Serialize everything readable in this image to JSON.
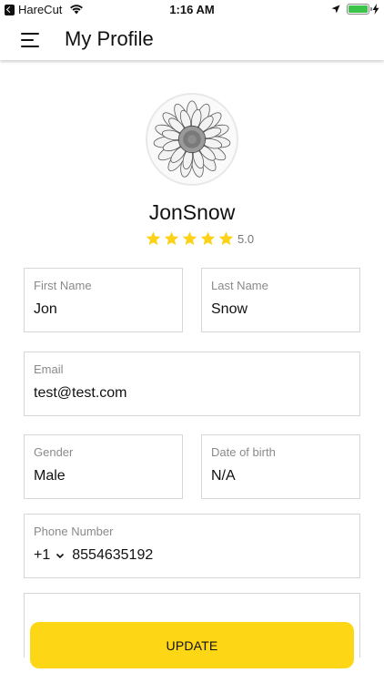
{
  "status_bar": {
    "back_app": "HareCut",
    "time": "1:16 AM",
    "battery_color": "#3cc34a"
  },
  "header": {
    "menu_icon": "hamburger-menu-icon",
    "title": "My Profile"
  },
  "profile": {
    "avatar_icon": "sunflower-avatar",
    "username": "JonSnow",
    "rating": {
      "stars_filled": 5,
      "stars_total": 5,
      "value": "5.0",
      "star_color": "#fcd116"
    }
  },
  "form": {
    "first_name": {
      "label": "First Name",
      "value": "Jon"
    },
    "last_name": {
      "label": "Last Name",
      "value": "Snow"
    },
    "email": {
      "label": "Email",
      "value": "test@test.com"
    },
    "gender": {
      "label": "Gender",
      "value": "Male"
    },
    "dob": {
      "label": "Date of birth",
      "value": "N/A"
    },
    "phone": {
      "label": "Phone Number",
      "country_code": "+1",
      "number": "8554635192"
    }
  },
  "actions": {
    "update_label": "UPDATE",
    "accent_color": "#fdd716"
  }
}
